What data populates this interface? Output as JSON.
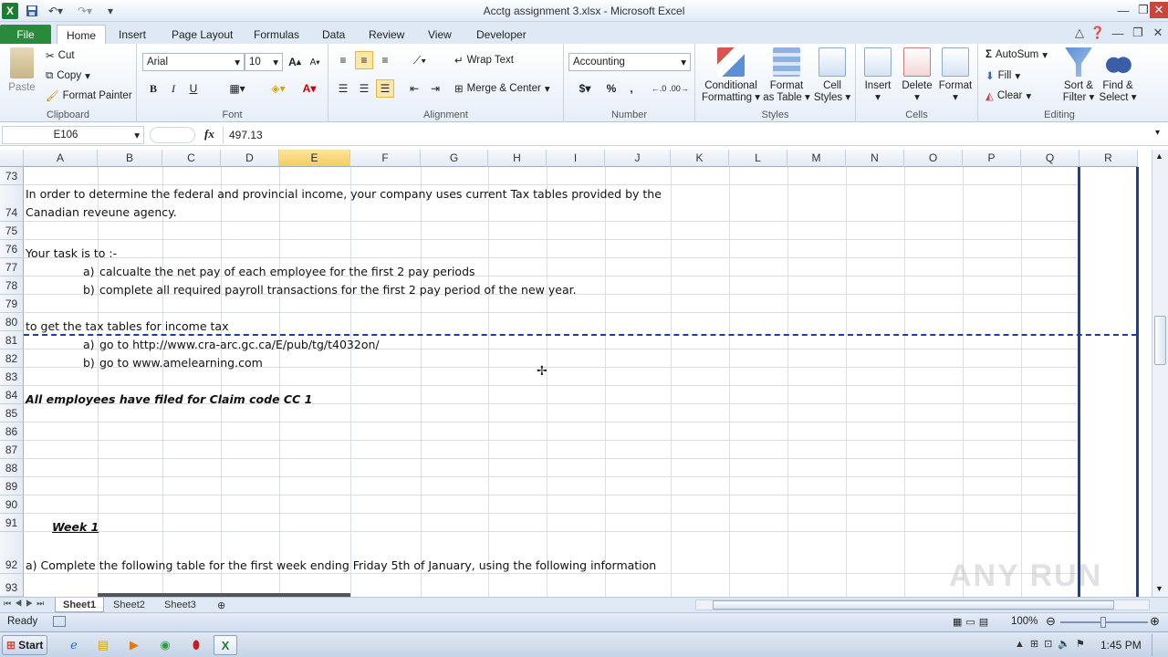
{
  "window": {
    "title": "Acctg assignment 3.xlsx - Microsoft Excel",
    "app_icon": "X"
  },
  "tabs": [
    "File",
    "Home",
    "Insert",
    "Page Layout",
    "Formulas",
    "Data",
    "Review",
    "View",
    "Developer"
  ],
  "ribbon": {
    "clipboard": {
      "paste": "Paste",
      "cut": "Cut",
      "copy": "Copy",
      "format_painter": "Format Painter",
      "label": "Clipboard"
    },
    "font": {
      "name": "Arial",
      "size": "10",
      "label": "Font",
      "bold": "B",
      "italic": "I",
      "underline": "U",
      "font_color_glyph": "A"
    },
    "alignment": {
      "wrap": "Wrap Text",
      "merge": "Merge & Center",
      "label": "Alignment"
    },
    "number": {
      "format": "Accounting",
      "currency": "$",
      "percent": "%",
      "comma": ",",
      "label": "Number"
    },
    "styles": {
      "conditional": "Conditional",
      "conditional2": "Formatting",
      "format_table": "Format",
      "format_table2": "as Table",
      "cell_styles": "Cell",
      "cell_styles2": "Styles",
      "label": "Styles"
    },
    "cells": {
      "insert": "Insert",
      "delete": "Delete",
      "format": "Format",
      "label": "Cells"
    },
    "editing": {
      "autosum": "AutoSum",
      "fill": "Fill",
      "clear": "Clear",
      "sort": "Sort &",
      "sort2": "Filter",
      "find": "Find &",
      "find2": "Select",
      "label": "Editing",
      "sigma": "Σ"
    }
  },
  "formula_bar": {
    "name_box": "E106",
    "fx": "fx",
    "value": "497.13"
  },
  "columns": [
    "A",
    "B",
    "C",
    "D",
    "E",
    "F",
    "G",
    "H",
    "I",
    "J",
    "K",
    "L",
    "M",
    "N",
    "O",
    "P",
    "Q",
    "R"
  ],
  "selected_column": "E",
  "rows": [
    "73",
    "74",
    "75",
    "76",
    "77",
    "78",
    "79",
    "80",
    "81",
    "82",
    "83",
    "84",
    "85",
    "86",
    "87",
    "88",
    "89",
    "90",
    "91",
    "92",
    "93"
  ],
  "cells": {
    "r74a": "In order to determine the federal and provincial income, your company uses current Tax tables provided by the",
    "r74b": "Canadian reveune agency.",
    "r76": "Your task is to :-",
    "r77_marker": "a)",
    "r77": "calcualte the net pay of each employee for the first 2 pay periods",
    "r78_marker": "b)",
    "r78": "complete all required payroll transactions for the first 2 pay period of the new year.",
    "r80": "to get the tax tables for income tax",
    "r81_marker": "a)",
    "r81": "go to http://www.cra-arc.gc.ca/E/pub/tg/t4032on/",
    "r82_marker": "b)",
    "r82": "go to www.amelearning.com",
    "r84": "All employees have filed for Claim code CC 1",
    "r91": "Week 1",
    "r92": "a) Complete the following table for the first week ending Friday 5th of January, using the following information"
  },
  "sheets": [
    "Sheet1",
    "Sheet2",
    "Sheet3"
  ],
  "active_sheet": "Sheet1",
  "status": {
    "mode": "Ready",
    "zoom": "100%"
  },
  "taskbar": {
    "start": "Start",
    "clock": "1:45 PM"
  },
  "watermark": "ANY RUN"
}
